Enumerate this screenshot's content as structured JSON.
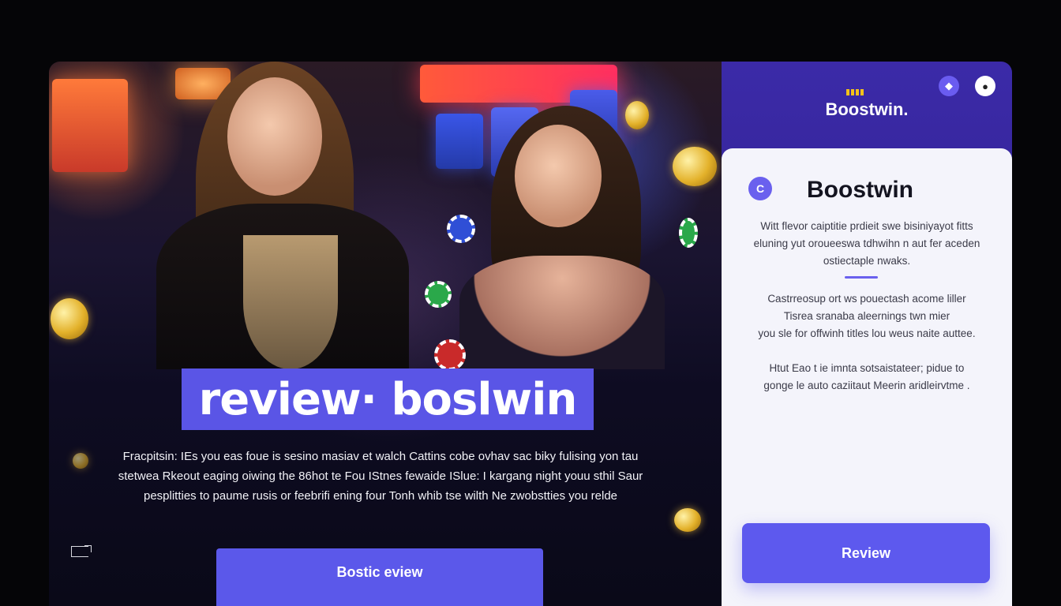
{
  "hero": {
    "banner_text": "review· boslwin",
    "description_lines": [
      "Fracpitsin: IEs you eas foue is sesino masiav et walch Cattins cobe ovhav sac biky fulising yon tau",
      "stetwea Rkeout eaging oiwing the 86hot te Fou IStnes fewaide ISlue: I kargang night youu sthil Saur",
      "pesplitties to paume rusis or feebrifi ening four Tonh whib tse wilth Ne zwobstties you relde"
    ],
    "cta_label": "Bostic eview"
  },
  "panel": {
    "brand": "Boostwin.",
    "card": {
      "logo_glyph": "C",
      "title": "Boostwin",
      "paragraph1": [
        "Witt flevor caiptitie prdieit swe bisiniyayot fitts",
        "eluning yut oroueeswa tdhwihn n aut fer aceden",
        "ostiectaple nwaks."
      ],
      "paragraph2": [
        "Castrreosup ort ws pouectash acome liller",
        "Tisrea sranaba aleernings twn mier",
        "you sle for offwinh titles lou weus naite auttee."
      ],
      "paragraph3": [
        "Htut Eao t ie imnta sotsaistateer; pidue to",
        "gonge le auto caziitaut Meerin aridleirvtme ."
      ],
      "cta_label": "Review"
    }
  },
  "colors": {
    "accent": "#5b58ea",
    "panel_bg": "#3b2aa8",
    "card_bg": "#f4f4fb",
    "coin": "#e3b12a"
  },
  "icons": {
    "panel_left": "diamond-icon",
    "panel_right": "user-icon",
    "corner": "expand-icon"
  }
}
